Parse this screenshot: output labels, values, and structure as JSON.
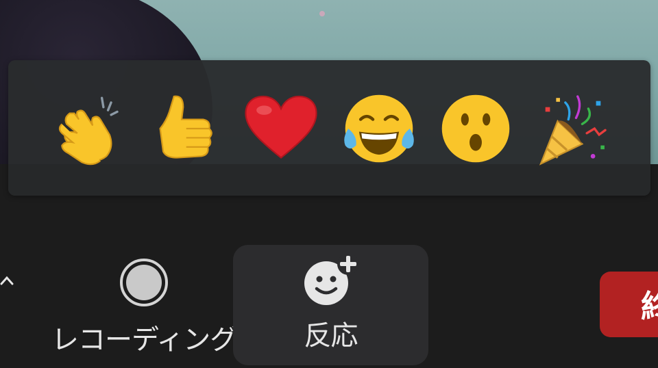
{
  "reactions": [
    {
      "name": "clapping-hands",
      "icon": "clap-icon"
    },
    {
      "name": "thumbs-up",
      "icon": "thumbs-up-icon"
    },
    {
      "name": "heart",
      "icon": "heart-icon"
    },
    {
      "name": "tears-of-joy",
      "icon": "tears-of-joy-icon"
    },
    {
      "name": "surprised",
      "icon": "surprised-face-icon"
    },
    {
      "name": "party-popper",
      "icon": "party-popper-icon"
    }
  ],
  "toolbar": {
    "recording_label": "レコーディング",
    "reactions_label": "反応",
    "end_label": "終"
  },
  "colors": {
    "toolbar_bg": "#1c1c1c",
    "panel_bg": "#2a2c2e",
    "active_button_bg": "#2c2c2e",
    "end_button": "#b22222",
    "emoji_yellow": "#f9c52a",
    "heart_red": "#e0212c"
  }
}
